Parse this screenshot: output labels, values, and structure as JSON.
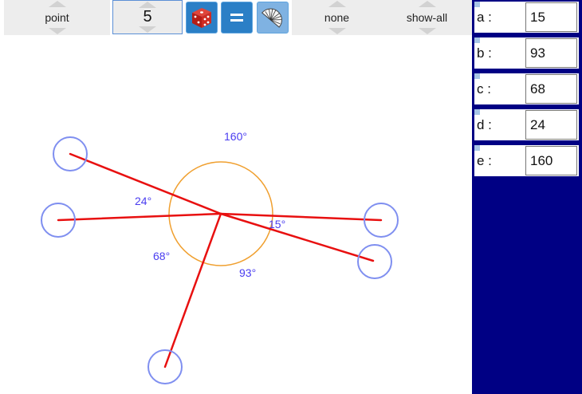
{
  "toolbar": {
    "mode_select": "point",
    "count_value": "5",
    "dice_icon": "dice-icon",
    "equal_icon": "equals-icon",
    "protractor_icon": "protractor-icon",
    "label_select": "none",
    "show_select": "show-all"
  },
  "params": [
    {
      "name": "a :",
      "value": "15"
    },
    {
      "name": "b :",
      "value": "93"
    },
    {
      "name": "c :",
      "value": "68"
    },
    {
      "name": "d :",
      "value": "24"
    },
    {
      "name": "e :",
      "value": "160"
    }
  ],
  "angles": {
    "a": "15°",
    "b": "93°",
    "c": "68°",
    "d": "24°",
    "e": "160°"
  },
  "colors": {
    "ray": "#e81010",
    "handle": "#7f8ff0",
    "arc": "#f0a030",
    "angle_label": "#4a3df0",
    "panel": "#000084"
  }
}
